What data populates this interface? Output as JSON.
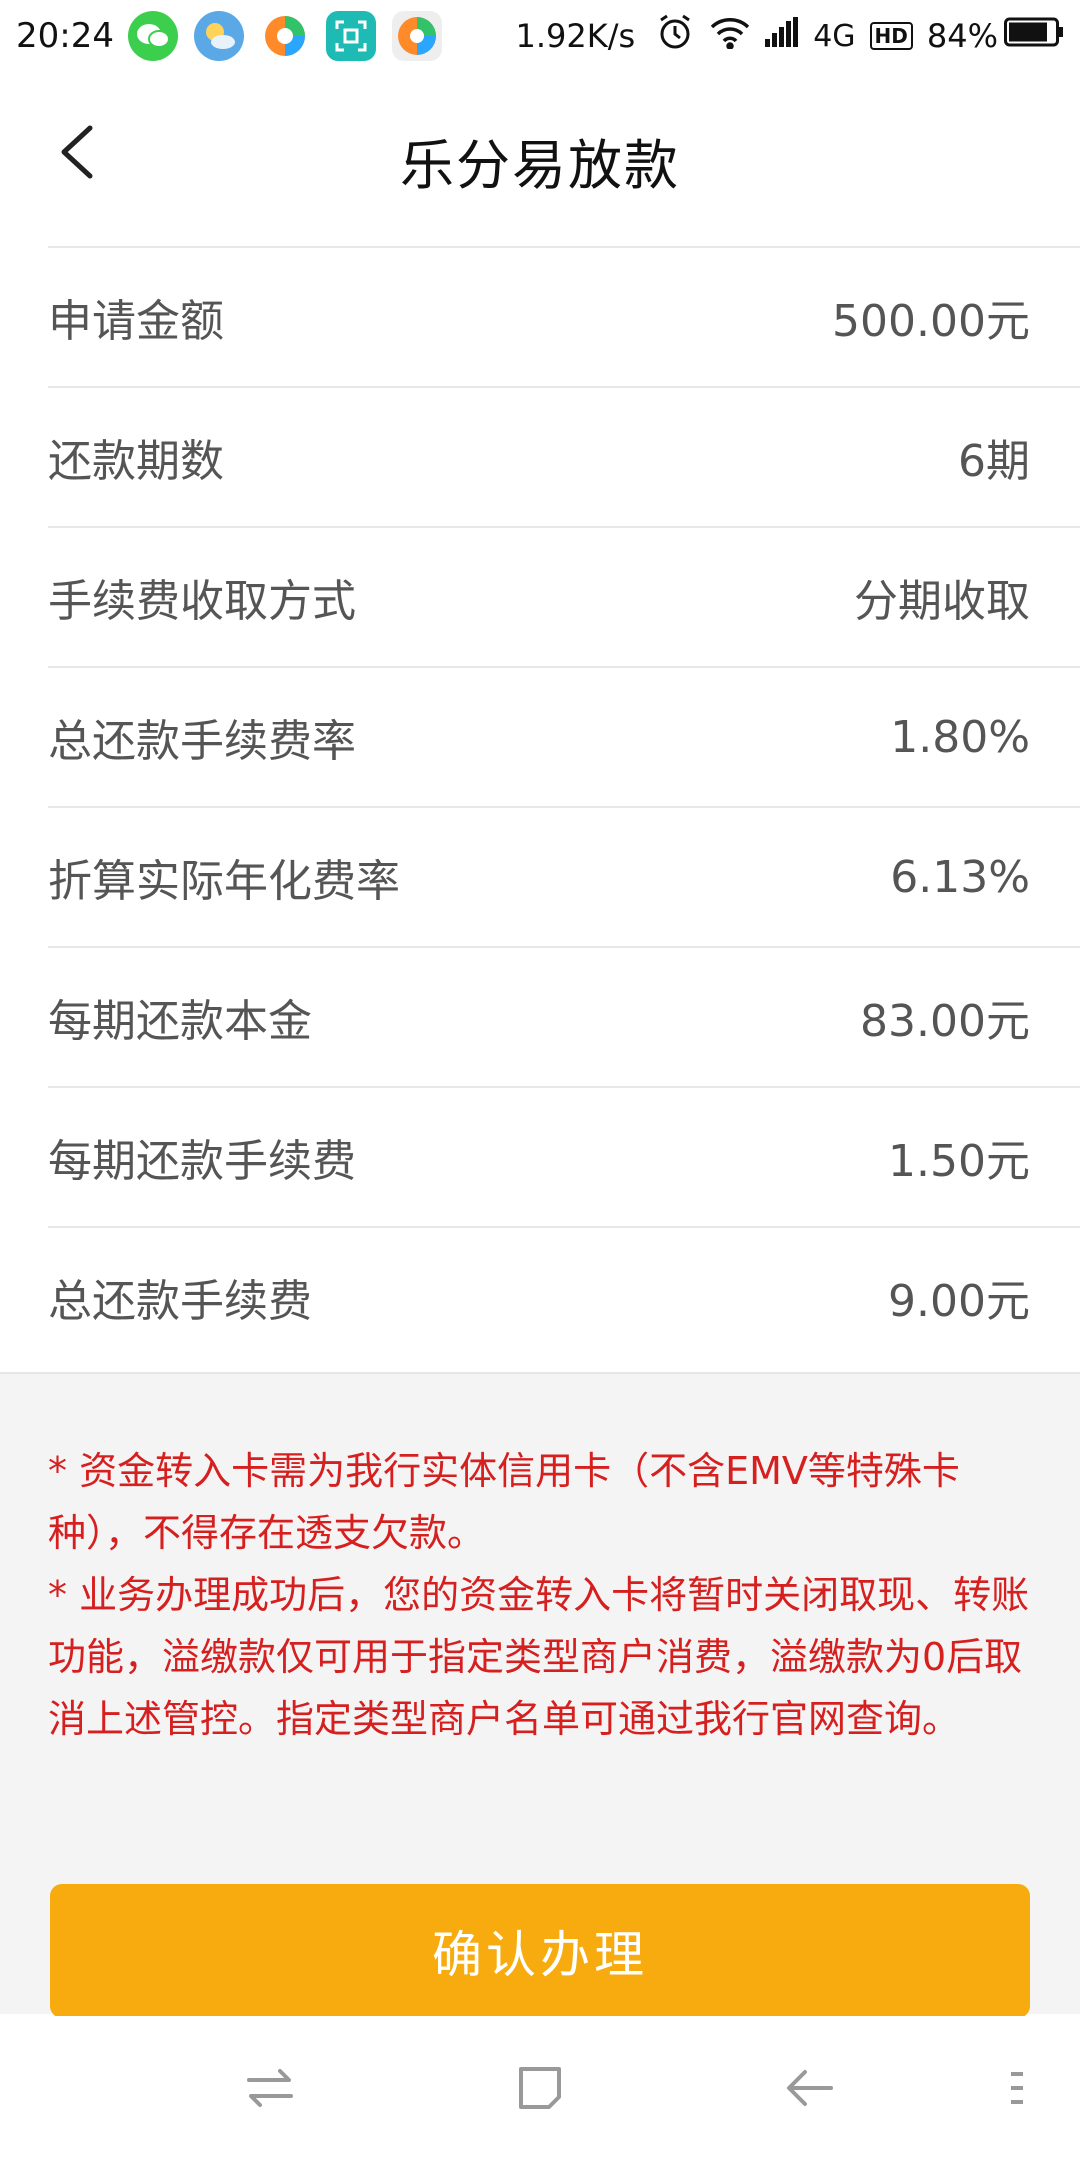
{
  "status_bar": {
    "time": "20:24",
    "net_speed": "1.92K/s",
    "network": "4G",
    "hd": "HD",
    "battery": "84%"
  },
  "header": {
    "title": "乐分易放款"
  },
  "details": [
    {
      "label": "申请金额",
      "value": "500.00元"
    },
    {
      "label": "还款期数",
      "value": "6期"
    },
    {
      "label": "手续费收取方式",
      "value": "分期收取"
    },
    {
      "label": "总还款手续费率",
      "value": "1.80%"
    },
    {
      "label": "折算实际年化费率",
      "value": "6.13%"
    },
    {
      "label": "每期还款本金",
      "value": "83.00元"
    },
    {
      "label": "每期还款手续费",
      "value": "1.50元"
    },
    {
      "label": "总还款手续费",
      "value": "9.00元"
    }
  ],
  "notes": [
    "* 资金转入卡需为我行实体信用卡（不含EMV等特殊卡种），不得存在透支欠款。",
    "* 业务办理成功后，您的资金转入卡将暂时关闭取现、转账功能，溢缴款仅可用于指定类型商户消费，溢缴款为0后取消上述管控。指定类型商户名单可通过我行官网查询。"
  ],
  "confirm_label": "确认办理",
  "colors": {
    "accent": "#f7ab0e",
    "warning_text": "#d61f1f"
  }
}
